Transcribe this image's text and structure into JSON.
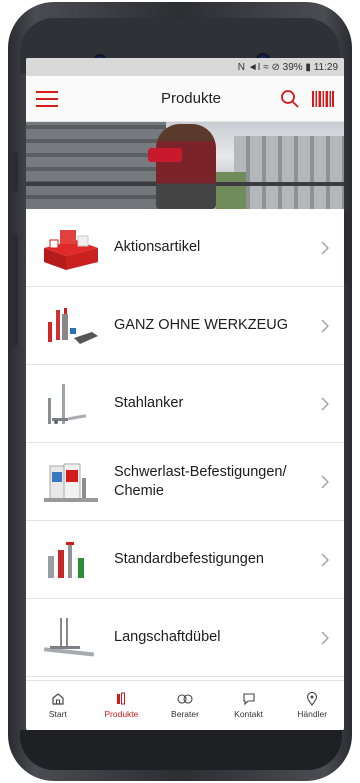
{
  "status_bar": {
    "text": "N ◄I ≈ ⊘ 39% ▮ 11:29"
  },
  "header": {
    "title": "Produkte"
  },
  "products": [
    {
      "label": "Aktionsartikel",
      "icon": "promo-boxes-icon"
    },
    {
      "label": "GANZ OHNE WERKZEUG",
      "icon": "no-tool-set-icon"
    },
    {
      "label": "Stahlanker",
      "icon": "steel-anchor-icon"
    },
    {
      "label": "Schwerlast-Befestigungen/ Chemie",
      "icon": "chemical-cartridge-icon"
    },
    {
      "label": "Standardbefestigungen",
      "icon": "standard-plugs-icon"
    },
    {
      "label": "Langschaftdübel",
      "icon": "long-shaft-plug-icon"
    }
  ],
  "nav": [
    {
      "label": "Start",
      "icon": "home-icon",
      "active": false
    },
    {
      "label": "Produkte",
      "icon": "product-icon",
      "active": true
    },
    {
      "label": "Berater",
      "icon": "advisor-icon",
      "active": false
    },
    {
      "label": "Kontakt",
      "icon": "contact-icon",
      "active": false
    },
    {
      "label": "Händler",
      "icon": "location-pin-icon",
      "active": false
    }
  ],
  "colors": {
    "accent": "#d51a1a",
    "text": "#1c1c1c",
    "divider": "#e3e3e3"
  }
}
